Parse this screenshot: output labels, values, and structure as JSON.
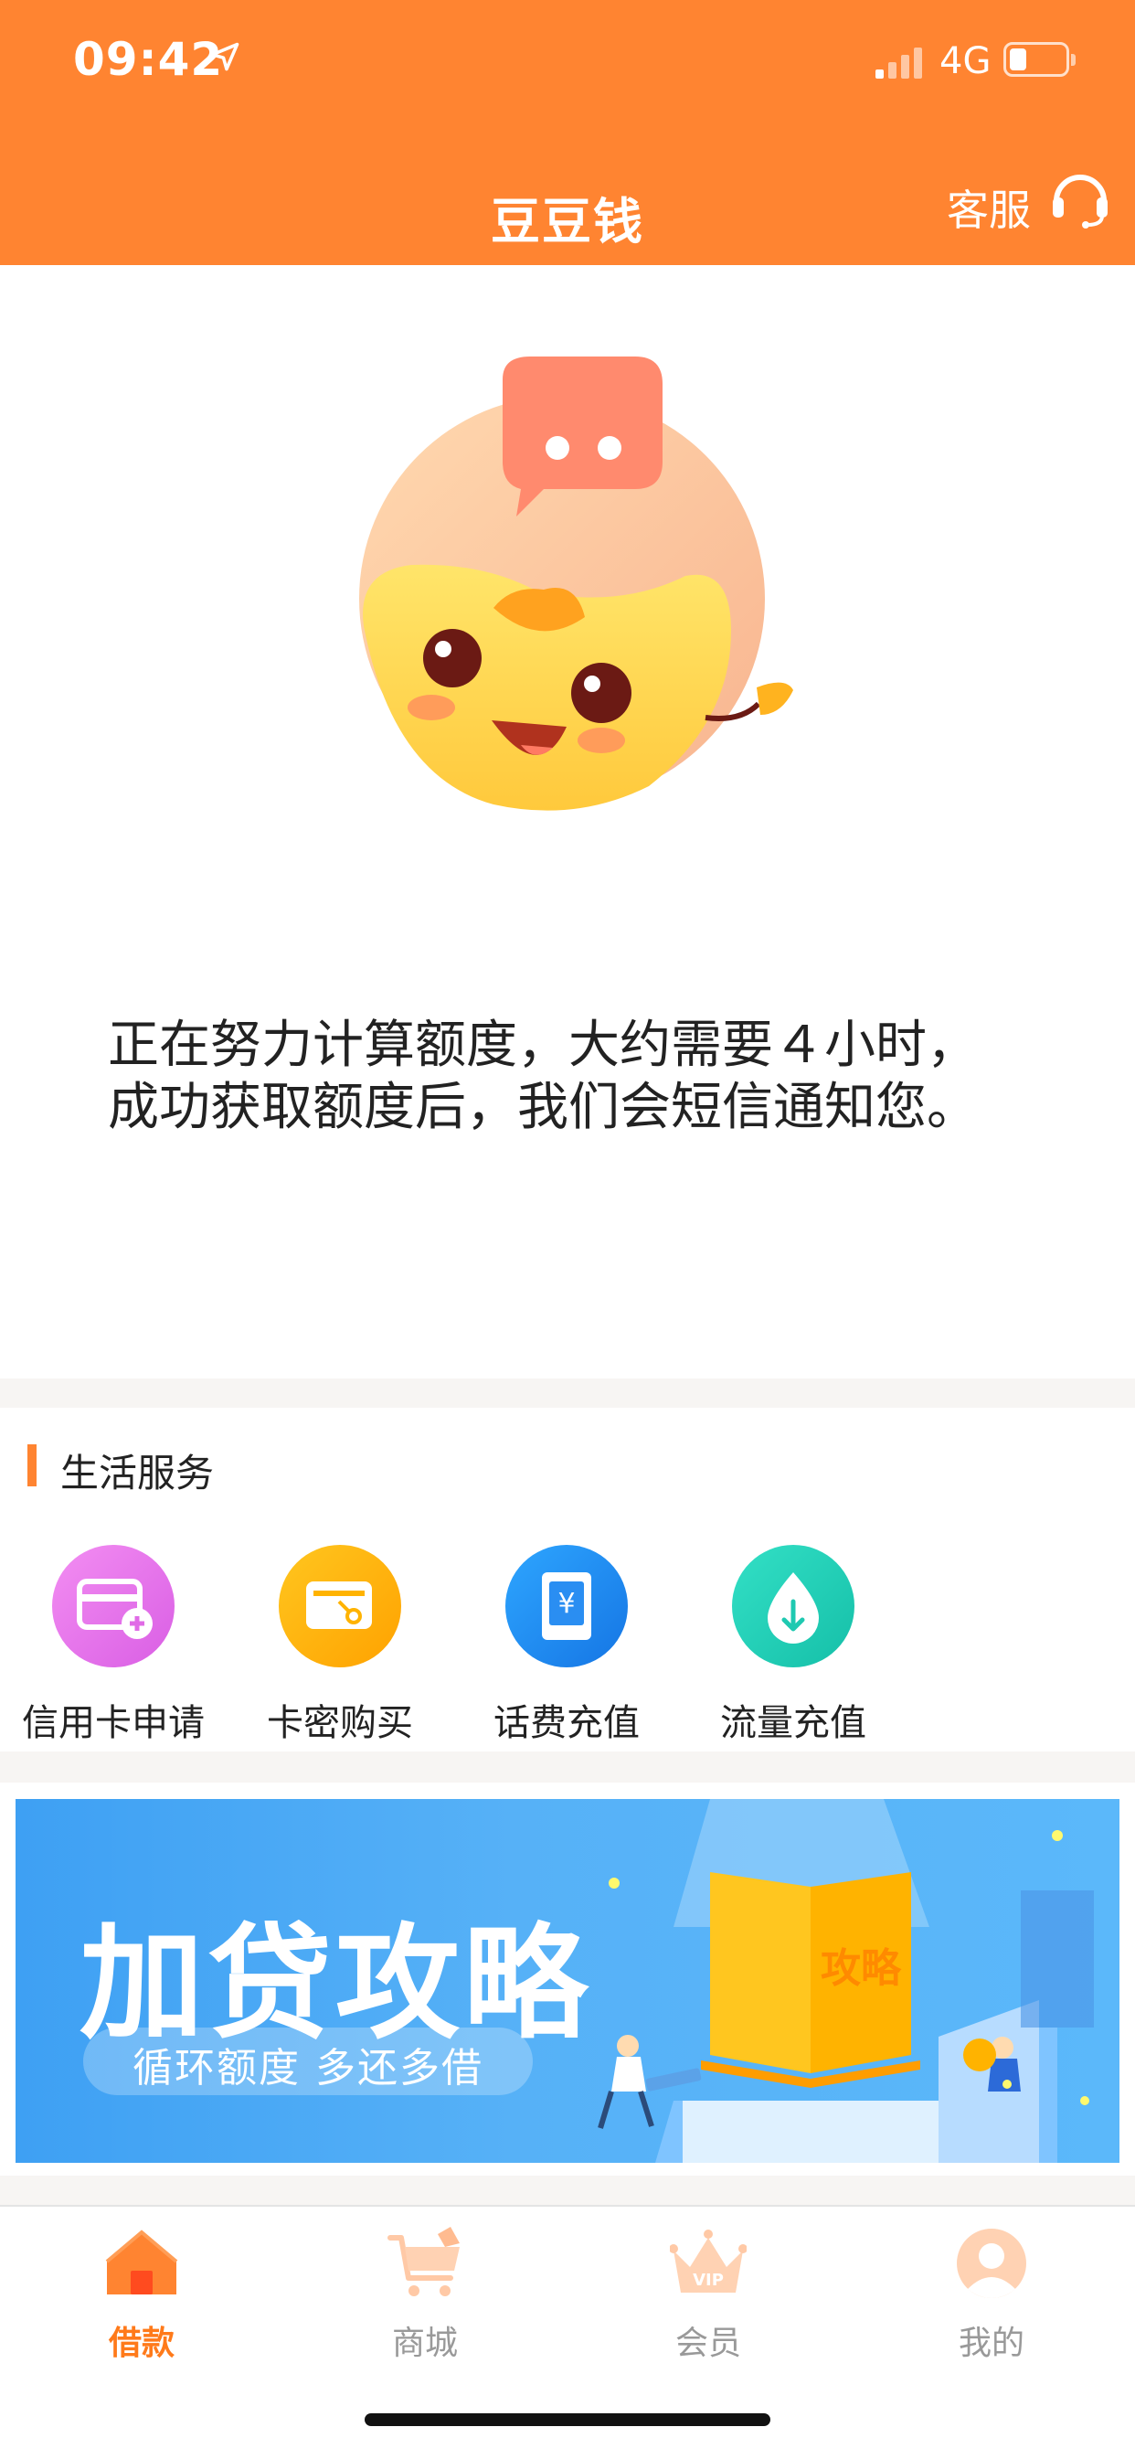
{
  "status": {
    "time": "09:42",
    "network": "4G",
    "battery_level_fraction": 0.25
  },
  "header": {
    "title": "豆豆钱",
    "service_label": "客服"
  },
  "message": {
    "line1": "正在努力计算额度，大约需要４小时，",
    "line2": "成功获取额度后，我们会短信通知您。"
  },
  "services": {
    "section_title": "生活服务",
    "items": [
      {
        "label": "信用卡申请",
        "icon": "credit-card-icon",
        "color": "#e76ee8"
      },
      {
        "label": "卡密购买",
        "icon": "card-key-icon",
        "color": "#ffb300"
      },
      {
        "label": "话费充值",
        "icon": "phone-bill-icon",
        "color": "#1e8ef0"
      },
      {
        "label": "流量充值",
        "icon": "data-drop-icon",
        "color": "#1fd1b9"
      }
    ]
  },
  "banner": {
    "title": "加贷攻略",
    "subtitle": "循环额度 多还多借",
    "book_text": "攻略"
  },
  "tabs": [
    {
      "label": "借款",
      "icon": "home-icon",
      "active": true
    },
    {
      "label": "商城",
      "icon": "cart-icon",
      "active": false
    },
    {
      "label": "会员",
      "icon": "crown-icon",
      "active": false,
      "badge": "VIP"
    },
    {
      "label": "我的",
      "icon": "user-icon",
      "active": false
    }
  ],
  "colors": {
    "brand": "#ff8431",
    "active_tab": "#ff7a1a",
    "inactive_tab": "#999999"
  }
}
